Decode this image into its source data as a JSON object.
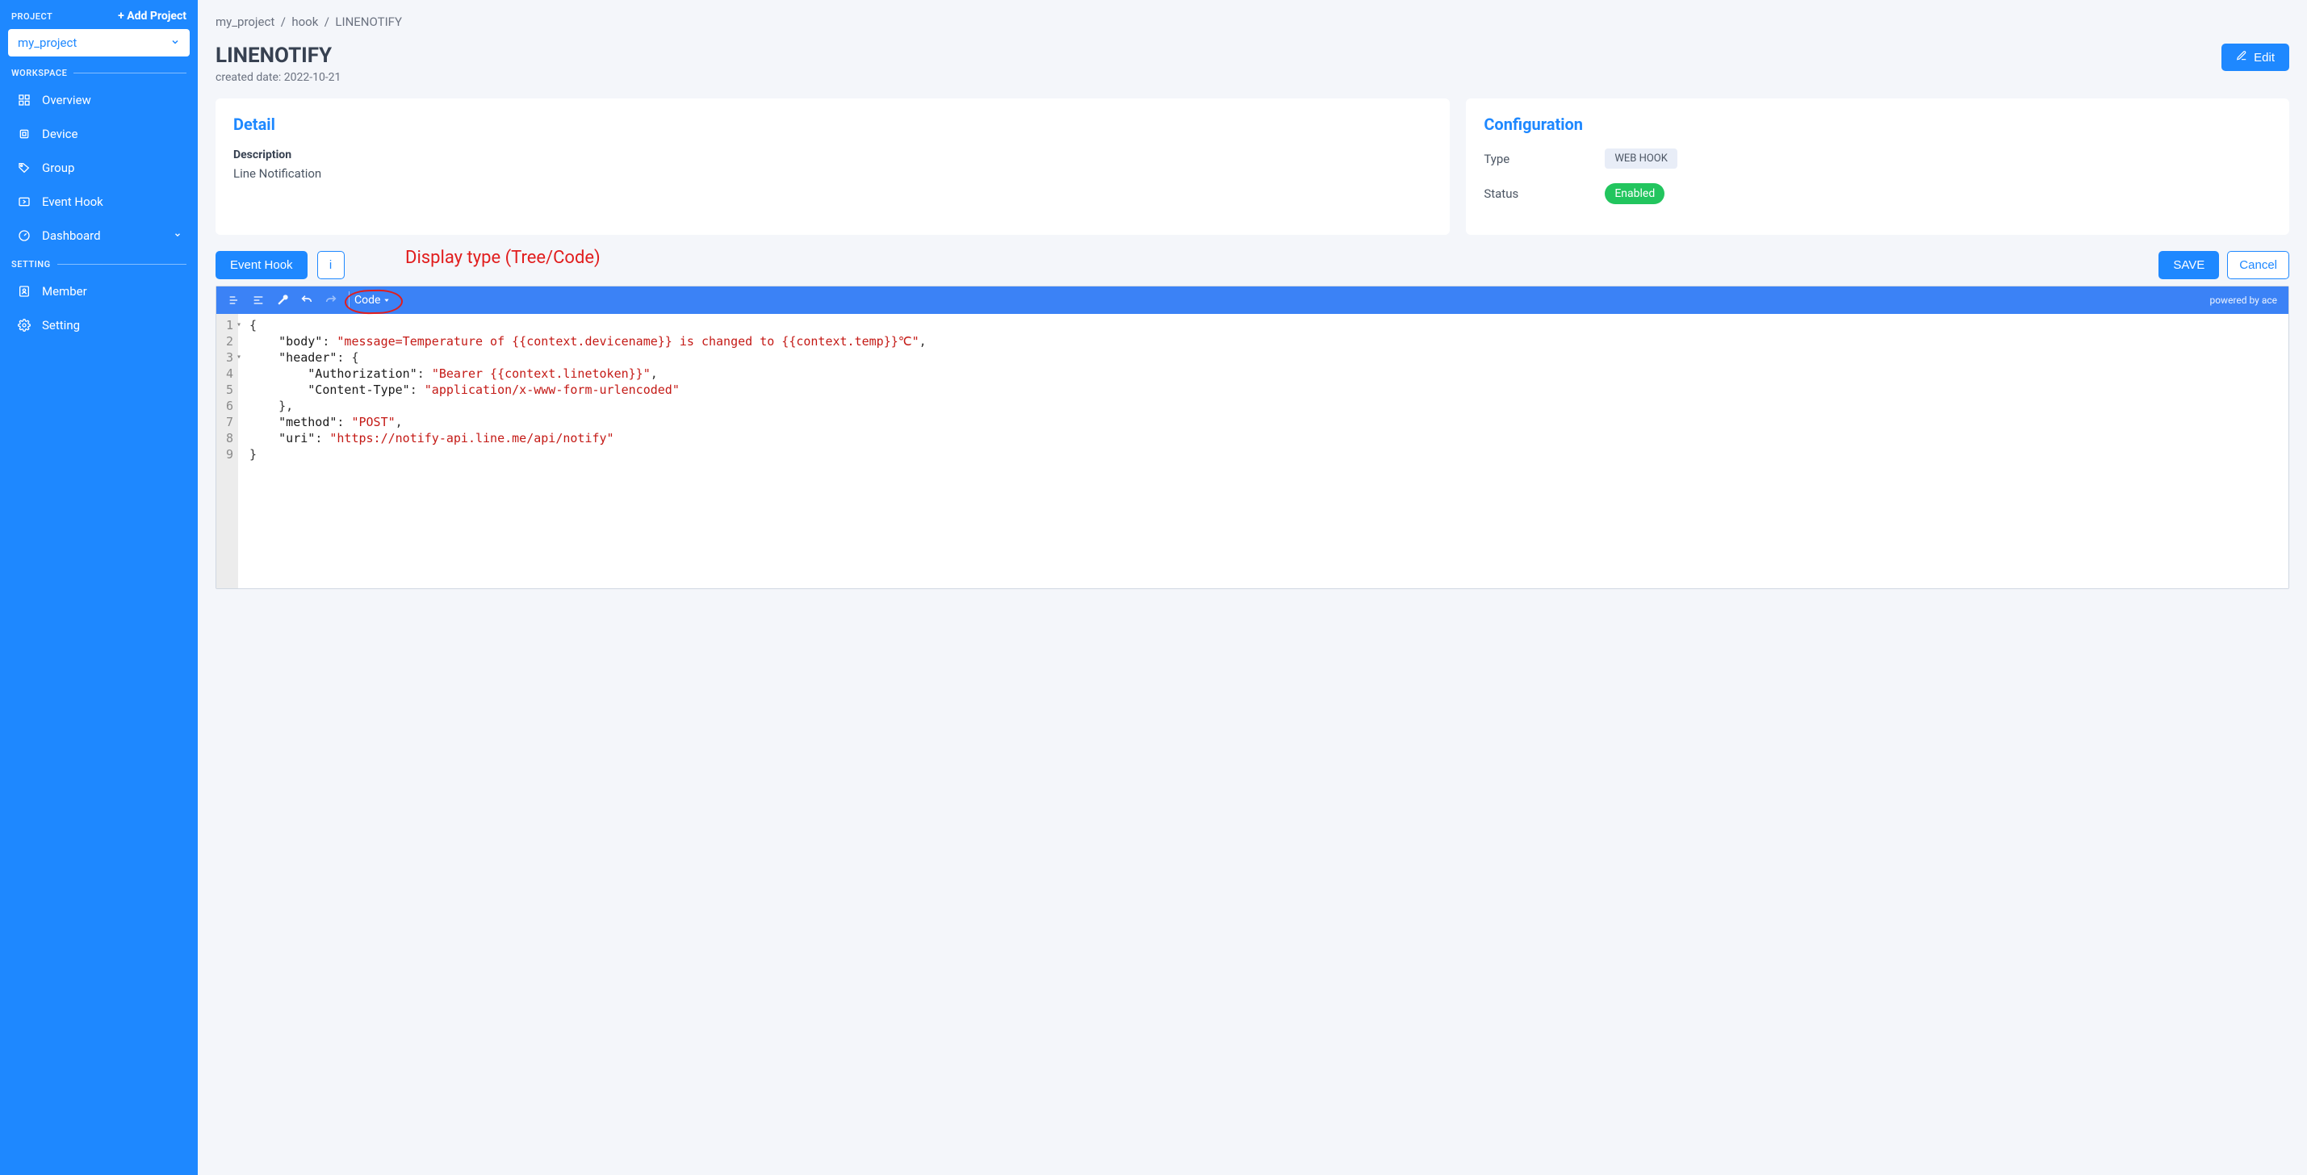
{
  "sidebar": {
    "project_label": "PROJECT",
    "add_project": "+ Add Project",
    "project_select": "my_project",
    "workspace_label": "WORKSPACE",
    "setting_label": "SETTING",
    "items": {
      "overview": "Overview",
      "device": "Device",
      "group": "Group",
      "event_hook": "Event Hook",
      "dashboard": "Dashboard",
      "member": "Member",
      "setting": "Setting"
    }
  },
  "breadcrumb": {
    "p1": "my_project",
    "p2": "hook",
    "p3": "LINENOTIFY",
    "sep": "/"
  },
  "page": {
    "title": "LINENOTIFY",
    "created": "created date: 2022-10-21",
    "edit": "Edit"
  },
  "detail": {
    "title": "Detail",
    "desc_label": "Description",
    "desc_text": "Line Notification"
  },
  "config": {
    "title": "Configuration",
    "type_label": "Type",
    "type_value": "WEB HOOK",
    "status_label": "Status",
    "status_value": "Enabled"
  },
  "actions": {
    "event_hook": "Event Hook",
    "info": "i",
    "save": "SAVE",
    "cancel": "Cancel"
  },
  "annotation": "Display type (Tree/Code)",
  "editor": {
    "mode": "Code",
    "powered": "powered by ace",
    "lines": [
      "{",
      "    \"body\": \"message=Temperature of {{context.devicename}} is changed to {{context.temp}}℃\",",
      "    \"header\": {",
      "        \"Authorization\": \"Bearer {{context.linetoken}}\",",
      "        \"Content-Type\": \"application/x-www-form-urlencoded\"",
      "    },",
      "    \"method\": \"POST\",",
      "    \"uri\": \"https://notify-api.line.me/api/notify\"",
      "}"
    ]
  },
  "code_payload": {
    "body": "message=Temperature of {{context.devicename}} is changed to {{context.temp}}℃",
    "header": {
      "Authorization": "Bearer {{context.linetoken}}",
      "Content-Type": "application/x-www-form-urlencoded"
    },
    "method": "POST",
    "uri": "https://notify-api.line.me/api/notify"
  }
}
